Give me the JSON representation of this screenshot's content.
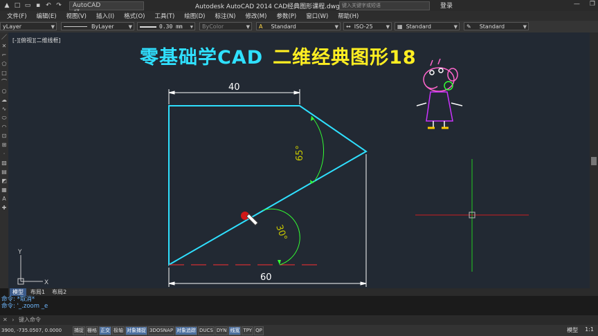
{
  "window": {
    "workspace": "AutoCAD 经典",
    "title": "Autodesk AutoCAD 2014    CAD经典图形课程.dwg",
    "search_placeholder": "键入关键字或短语",
    "login": "登录"
  },
  "menu": [
    "文件(F)",
    "编辑(E)",
    "视图(V)",
    "插入(I)",
    "格式(O)",
    "工具(T)",
    "绘图(D)",
    "标注(N)",
    "修改(M)",
    "参数(P)",
    "窗口(W)",
    "帮助(H)"
  ],
  "properties": {
    "layer": "yLayer",
    "linetype": "ByLayer",
    "lineweight": "0.30 mm",
    "color": "ByColor",
    "text_style": "Standard",
    "dim_style": "ISO-25",
    "table_style": "Standard",
    "multileader_style": "Standard"
  },
  "viewport": {
    "label": "[-][俯视][二维线框]",
    "headline_part1": "零基础学CAD",
    "headline_part2": "二维经典图形18"
  },
  "drawing": {
    "dim_top": "40",
    "dim_bottom": "60",
    "angle_upper": "65°",
    "angle_lower": "30°",
    "ucs_x": "X",
    "ucs_y": "Y",
    "colors": {
      "outline": "#2fe0ff",
      "dimension": "#ffffff",
      "angle_text": "#c8c800",
      "angle_arc": "#33ff33",
      "centerline": "#ff3030",
      "cross_v": "#22cc22",
      "cross_h": "#cc2020"
    }
  },
  "layout_tabs": [
    "模型",
    "布局1",
    "布局2"
  ],
  "command_history": [
    "命令: *取消*",
    "命令: '_.zoom _e"
  ],
  "command_prompt": "键入命令",
  "status": {
    "coords": "3900, -735.0507, 0.0000",
    "toggles": [
      {
        "label": "捕捉",
        "on": false
      },
      {
        "label": "栅格",
        "on": false
      },
      {
        "label": "正交",
        "on": true
      },
      {
        "label": "极轴",
        "on": false
      },
      {
        "label": "对象捕捉",
        "on": true
      },
      {
        "label": "3DOSNAP",
        "on": false
      },
      {
        "label": "对象追踪",
        "on": true
      },
      {
        "label": "DUCS",
        "on": false
      },
      {
        "label": "DYN",
        "on": false
      },
      {
        "label": "线宽",
        "on": true
      },
      {
        "label": "TPY",
        "on": false
      },
      {
        "label": "QP",
        "on": false
      }
    ],
    "model": "模型",
    "scale": "1:1"
  }
}
